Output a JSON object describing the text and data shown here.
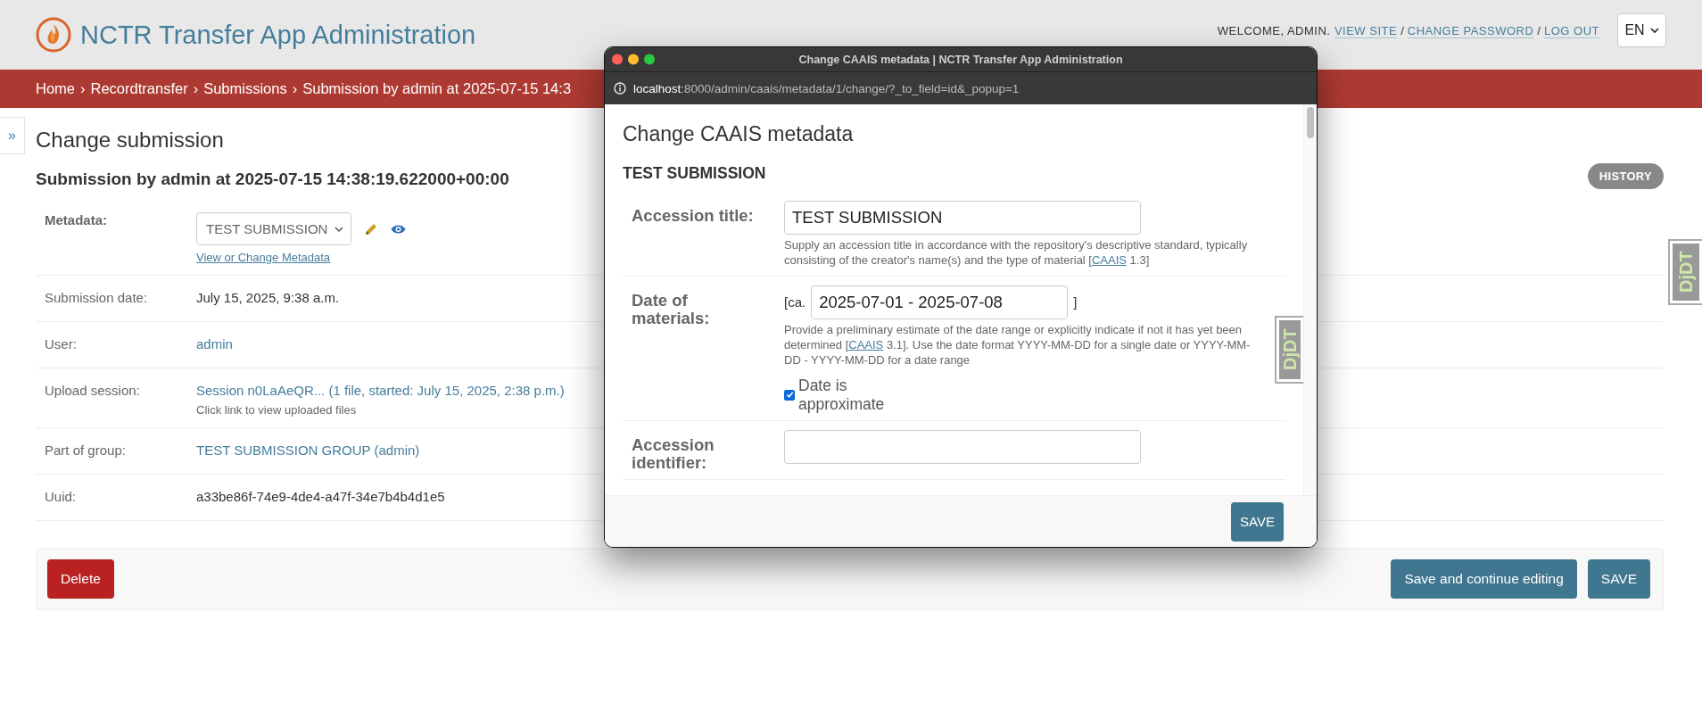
{
  "header": {
    "title": "NCTR Transfer App Administration",
    "welcome": "WELCOME, ADMIN.",
    "links": [
      "VIEW SITE",
      "CHANGE PASSWORD",
      "LOG OUT"
    ],
    "link_separator": "/",
    "language": "EN"
  },
  "breadcrumbs": {
    "items": [
      "Home",
      "Recordtransfer",
      "Submissions",
      "Submission by admin at 2025-07-15 14:3"
    ],
    "separator": "›"
  },
  "sidebar_toggle": "»",
  "page": {
    "title": "Change submission",
    "subtitle": "Submission by admin at 2025-07-15 14:38:19.622000+00:00",
    "history_button": "HISTORY",
    "fields": [
      {
        "kind": "select",
        "label": "Metadata:",
        "value": "TEST SUBMISSION",
        "link": "View or Change Metadata"
      },
      {
        "kind": "text",
        "label": "Submission date:",
        "value": "July 15, 2025, 9:38 a.m."
      },
      {
        "kind": "link",
        "label": "User:",
        "value": "admin"
      },
      {
        "kind": "link",
        "label": "Upload session:",
        "value": "Session n0LaAeQR... (1 file, started: July 15, 2025, 2:38 p.m.)",
        "help": "Click link to view uploaded files"
      },
      {
        "kind": "link",
        "label": "Part of group:",
        "value": "TEST SUBMISSION GROUP (admin)"
      },
      {
        "kind": "text",
        "label": "Uuid:",
        "value": "a33be86f-74e9-4de4-a47f-34e7b4b4d1e5"
      }
    ],
    "delete_button": "Delete",
    "save_buttons": [
      "Save and continue editing",
      "SAVE"
    ]
  },
  "debug_handle": "DjDT",
  "popup": {
    "title": "Change CAAIS metadata | NCTR Transfer App Administration",
    "url_host": "localhost",
    "url_path": ":8000/admin/caais/metadata/1/change/?_to_field=id&_popup=1",
    "heading": "Change CAAIS metadata",
    "subtitle": "TEST SUBMISSION",
    "fields": [
      {
        "kind": "text",
        "label": "Accession title:",
        "value": "TEST SUBMISSION",
        "help_before": "Supply an accession title in accordance with the repository's descriptive standard, typically consisting of the creator's name(s) and the type of material [",
        "help_link": "CAAIS",
        "help_after": " 1.3]"
      },
      {
        "kind": "date",
        "label": "Date of materials:",
        "prefix": "[ca.",
        "value": "2025-07-01 - 2025-07-08",
        "suffix": "]",
        "help_before": "Provide a preliminary estimate of the date range or explicitly indicate if not it has yet been determined [",
        "help_link": "CAAIS",
        "help_after": " 3.1]. Use the date format YYYY-MM-DD for a single date or YYYY-MM-DD - YYYY-MM-DD for a date range",
        "checkbox": {
          "label": "Date is approximate",
          "checked": true
        }
      },
      {
        "kind": "text",
        "label": "Accession identifier:"
      }
    ],
    "save_button": "SAVE",
    "debug_handle": "DjDT"
  }
}
